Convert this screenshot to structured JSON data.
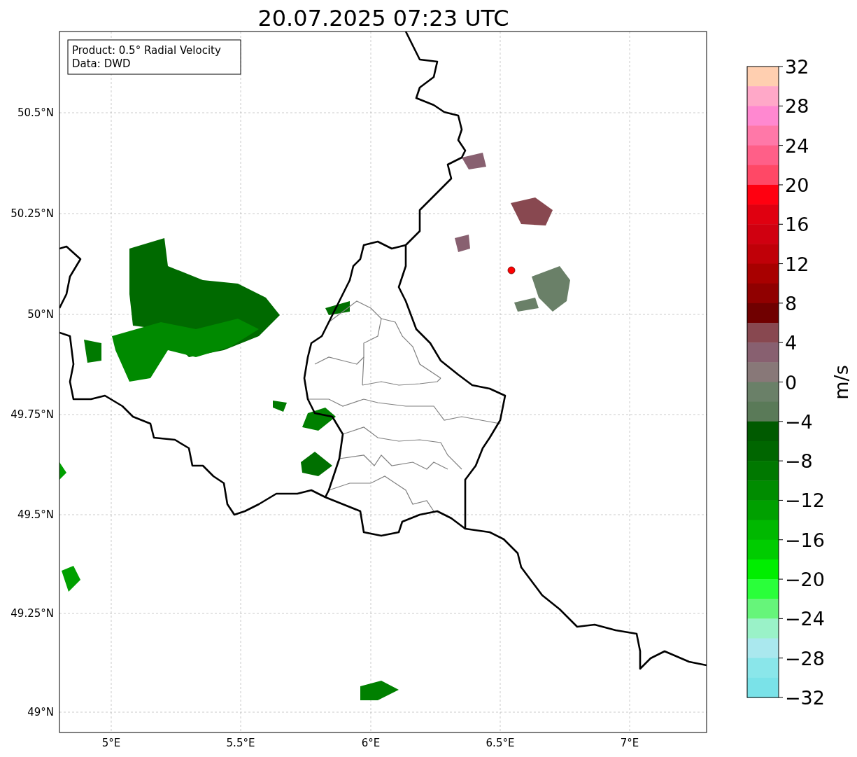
{
  "title": "20.07.2025 07:23 UTC",
  "info_box": {
    "lines": [
      "Product: 0.5° Radial Velocity",
      "Data: DWD"
    ]
  },
  "map": {
    "lon_ticks": [
      "5°E",
      "5.5°E",
      "6°E",
      "6.5°E",
      "7°E"
    ],
    "lat_ticks": [
      "50.5°N",
      "50.25°N",
      "50°N",
      "49.75°N",
      "49.5°N",
      "49.25°N",
      "49°N"
    ]
  },
  "colorbar": {
    "label": "m/s",
    "ticks": [
      "32",
      "28",
      "24",
      "20",
      "16",
      "12",
      "8",
      "4",
      "0",
      "−4",
      "−8",
      "−12",
      "−16",
      "−20",
      "−24",
      "−28",
      "−32"
    ],
    "segments": [
      {
        "color": "#ffcfb0"
      },
      {
        "color": "#ffa8c8"
      },
      {
        "color": "#ff88d0"
      },
      {
        "color": "#ff78a8"
      },
      {
        "color": "#ff5f88"
      },
      {
        "color": "#ff4866"
      },
      {
        "color": "#ff0010"
      },
      {
        "color": "#e00010"
      },
      {
        "color": "#d00010"
      },
      {
        "color": "#c00008"
      },
      {
        "color": "#a80000"
      },
      {
        "color": "#900000"
      },
      {
        "color": "#700000"
      },
      {
        "color": "#884850"
      },
      {
        "color": "#886070"
      },
      {
        "color": "#887878"
      },
      {
        "color": "#6a8068"
      },
      {
        "color": "#5a7a58"
      },
      {
        "color": "#005a00"
      },
      {
        "color": "#006600"
      },
      {
        "color": "#007800"
      },
      {
        "color": "#008c00"
      },
      {
        "color": "#00a000"
      },
      {
        "color": "#00b800"
      },
      {
        "color": "#00cc00"
      },
      {
        "color": "#00ee00"
      },
      {
        "color": "#2aff3a"
      },
      {
        "color": "#66f57a"
      },
      {
        "color": "#9af2c8"
      },
      {
        "color": "#aae8ee"
      },
      {
        "color": "#8ae6ea"
      },
      {
        "color": "#7ae2e8"
      }
    ]
  }
}
